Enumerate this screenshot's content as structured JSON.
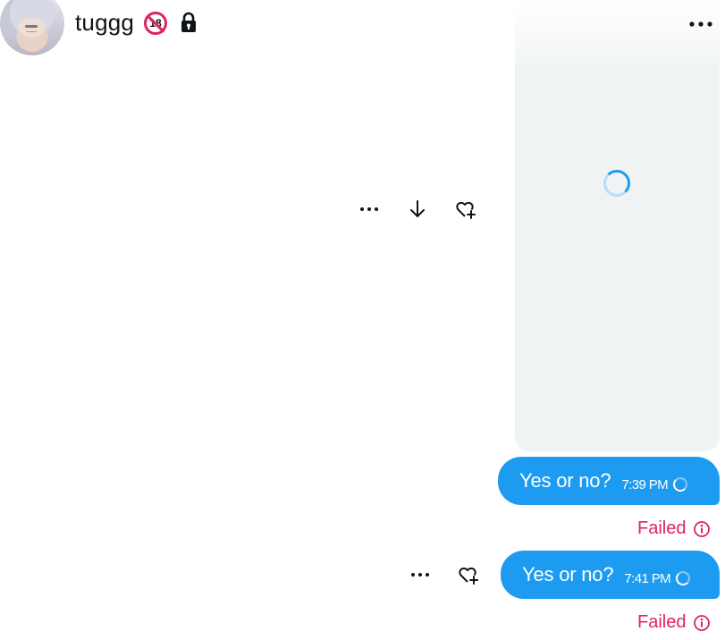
{
  "header": {
    "username": "tuggg",
    "age_badge": "18",
    "lock_icon": "lock-icon",
    "menu_icon": "more-horizontal-icon"
  },
  "media": {
    "state": "loading",
    "actions": {
      "more_icon": "more-horizontal-icon",
      "download_icon": "download-arrow-icon",
      "react_icon": "heart-plus-icon"
    }
  },
  "messages": [
    {
      "text": "Yes or no?",
      "time": "7:39 PM",
      "status": "Failed"
    },
    {
      "text": "Yes or no?",
      "time": "7:41 PM",
      "status": "Failed"
    }
  ],
  "colors": {
    "accent": "#1d9bf0",
    "error": "#e0245e",
    "panel": "#eff3f4"
  }
}
